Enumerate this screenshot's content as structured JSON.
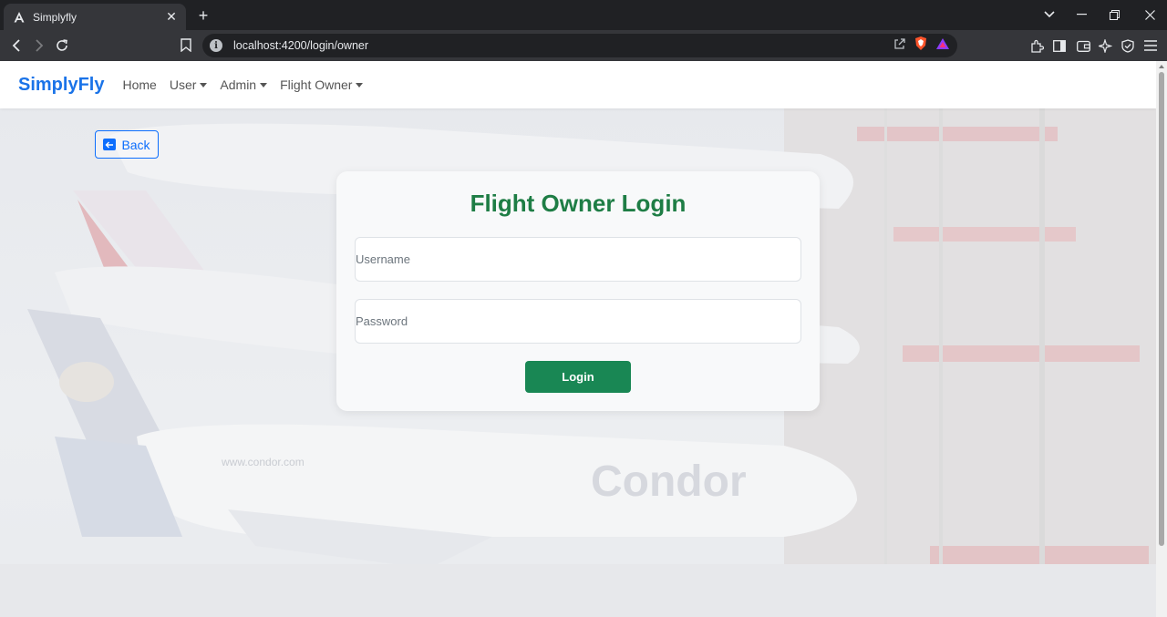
{
  "browser": {
    "tab": {
      "title": "Simplyfly",
      "favicon": "angular-icon"
    },
    "address": {
      "url": "localhost:4200/login/owner"
    },
    "colors": {
      "chrome_dark": "#202124",
      "chrome_toolbar": "#35363a"
    }
  },
  "navbar": {
    "brand": "SimplyFly",
    "links": [
      {
        "label": "Home",
        "dropdown": false
      },
      {
        "label": "User",
        "dropdown": true
      },
      {
        "label": "Admin",
        "dropdown": true
      },
      {
        "label": "Flight Owner",
        "dropdown": true
      }
    ]
  },
  "back_button": {
    "label": "Back",
    "icon": "arrow-left-square-icon"
  },
  "login_card": {
    "title": "Flight Owner Login",
    "username": {
      "placeholder": "Username",
      "value": ""
    },
    "password": {
      "placeholder": "Password",
      "value": ""
    },
    "submit_label": "Login"
  },
  "colors": {
    "brand": "#1a73e8",
    "title_green": "#1e7d45",
    "button_green": "#198754",
    "back_blue": "#0d6efd"
  }
}
